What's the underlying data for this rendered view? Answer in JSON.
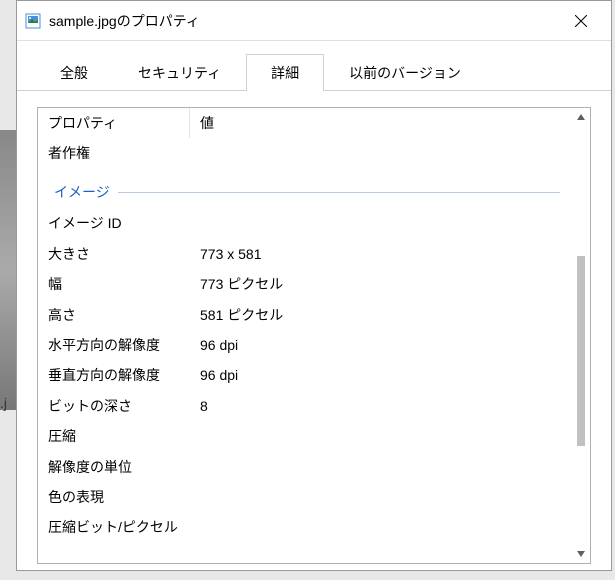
{
  "titlebar": {
    "title": "sample.jpgのプロパティ"
  },
  "tabs": {
    "general": "全般",
    "security": "セキュリティ",
    "details": "詳細",
    "previous": "以前のバージョン",
    "active": "details"
  },
  "columns": {
    "property": "プロパティ",
    "value": "値"
  },
  "rows_pre": [
    {
      "prop": "者作権",
      "val": ""
    }
  ],
  "section_image": "イメージ",
  "rows_image": [
    {
      "prop": "イメージ ID",
      "val": ""
    },
    {
      "prop": "大きさ",
      "val": "773 x 581"
    },
    {
      "prop": "幅",
      "val": "773 ピクセル"
    },
    {
      "prop": "高さ",
      "val": "581 ピクセル"
    },
    {
      "prop": "水平方向の解像度",
      "val": "96 dpi"
    },
    {
      "prop": "垂直方向の解像度",
      "val": "96 dpi"
    },
    {
      "prop": "ビットの深さ",
      "val": "8"
    },
    {
      "prop": "圧縮",
      "val": ""
    },
    {
      "prop": "解像度の単位",
      "val": ""
    },
    {
      "prop": "色の表現",
      "val": ""
    },
    {
      "prop": "圧縮ビット/ピクセル",
      "val": ""
    }
  ],
  "bg_label": ".j"
}
